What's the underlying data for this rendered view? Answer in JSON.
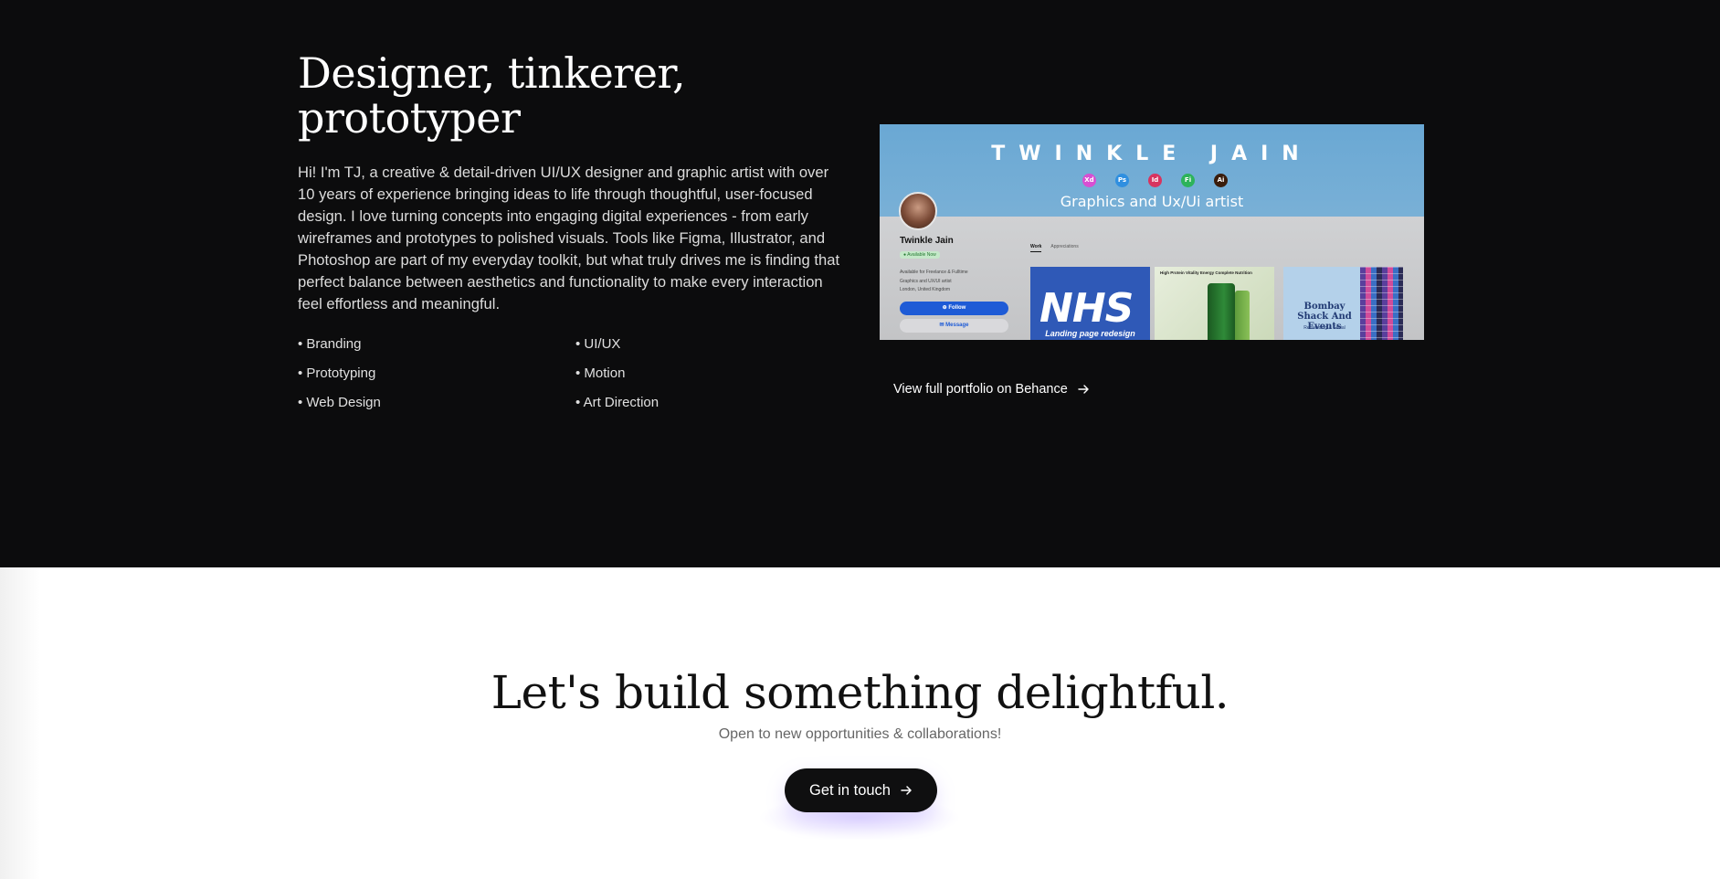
{
  "about": {
    "title_line1": "Designer, tinkerer,",
    "title_line2": "prototyper",
    "body": "Hi! I'm TJ, a creative & detail-driven UI/UX designer and graphic artist with over 10 years of experience bringing ideas to life through thoughtful, user-focused design. I love turning concepts into engaging digital experiences - from early wireframes and prototypes to polished visuals. Tools like Figma, Illustrator, and Photoshop are part of my everyday toolkit, but what truly drives me is finding that perfect balance between aesthetics and functionality to make every interaction feel effortless and meaningful.",
    "skills": [
      "• Branding",
      "• UI/UX",
      "• Prototyping",
      "• Motion",
      "• Web Design",
      "• Art Direction"
    ]
  },
  "portfolio_preview": {
    "name": "TWINKLE JAIN",
    "tagline": "Graphics and Ux/Ui artist",
    "tools": [
      {
        "label": "Xd",
        "color": "#d84fd2"
      },
      {
        "label": "Ps",
        "color": "#2f8fe0"
      },
      {
        "label": "Id",
        "color": "#d8345f"
      },
      {
        "label": "Fi",
        "color": "#2db35b"
      },
      {
        "label": "Ai",
        "color": "#3a1d0c"
      }
    ],
    "profile_name": "Twinkle Jain",
    "available_badge": "● Available Now",
    "meta_lines": [
      "Available for Freelance & Fulltime",
      "Graphics and UX/UI artist",
      "London, United Kingdom"
    ],
    "follow_label": "⊕ Follow",
    "message_label": "✉ Message",
    "tabs": [
      "Work",
      "Appreciations"
    ],
    "tiles": {
      "nhs_logo": "NHS",
      "nhs_caption": "Landing page redesign",
      "green_tags": "High Protein    Vitality Energy    Complete Nutrition",
      "bombay_title": "Bombay Shack And Events",
      "bombay_sub": "Rebranding & Social"
    }
  },
  "behance_link": {
    "label": "View full portfolio on Behance",
    "icon": "arrow-right-icon"
  },
  "cta": {
    "title": "Let's build something delightful.",
    "subtitle": "Open to new opportunities & collaborations!",
    "button_label": "Get in touch",
    "button_icon": "arrow-right-icon"
  },
  "colors": {
    "dark_bg": "#0c0c0d",
    "light_bg": "#ffffff",
    "follow_blue": "#1e5bd6"
  }
}
